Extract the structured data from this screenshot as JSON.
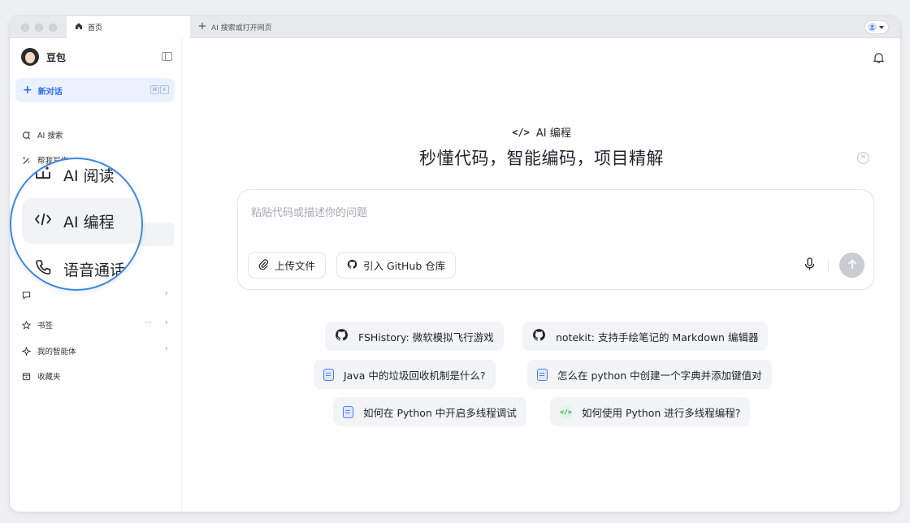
{
  "tabs": {
    "active_label": "首页",
    "new_tab_label": "AI 搜索或打开网页"
  },
  "sidebar": {
    "brand_name": "豆包",
    "new_chat_label": "新对话",
    "new_chat_shortcut": [
      "⌘",
      "K"
    ],
    "items": [
      {
        "label": "AI 搜索",
        "icon": "ai-search-icon"
      },
      {
        "label": "帮我写作",
        "icon": "pen-sparkle-icon"
      },
      {
        "label": "书签",
        "icon": "star-icon"
      },
      {
        "label": "我的智能体",
        "icon": "agent-sparkle-icon"
      },
      {
        "label": "收藏夹",
        "icon": "favorites-box-icon"
      }
    ],
    "bookmark_more": "···"
  },
  "magnifier": {
    "items": [
      {
        "label": "AI 阅读",
        "icon": "ai-read-icon"
      },
      {
        "label": "AI 编程",
        "icon": "code-icon"
      },
      {
        "label": "语音通话",
        "icon": "phone-icon"
      }
    ]
  },
  "main": {
    "mode_icon_text": "</>",
    "mode_label": "AI 编程",
    "headline": "秒懂代码，智能编码，项目精解",
    "input_placeholder": "粘贴代码或描述你的问题",
    "upload_label": "上传文件",
    "github_label": "引入 GitHub 仓库",
    "suggestions": [
      {
        "label": "FSHistory: 微软模拟飞行游戏",
        "icon": "github-icon"
      },
      {
        "label": "notekit: 支持手绘笔记的 Markdown 编辑器",
        "icon": "github-icon"
      },
      {
        "label": "Java 中的垃圾回收机制是什么?",
        "icon": "document-icon"
      },
      {
        "label": "怎么在 python 中创建一个字典并添加键值对",
        "icon": "document-icon"
      },
      {
        "label": "如何在 Python 中开启多线程调试",
        "icon": "document-icon"
      },
      {
        "label": "如何使用 Python 进行多线程编程?",
        "icon": "code-icon"
      }
    ],
    "code_icon_text": "</>"
  },
  "colors": {
    "accent": "#2d6bff",
    "magnifier_ring": "#3a86e8",
    "send_disabled": "#c9ccd1"
  }
}
